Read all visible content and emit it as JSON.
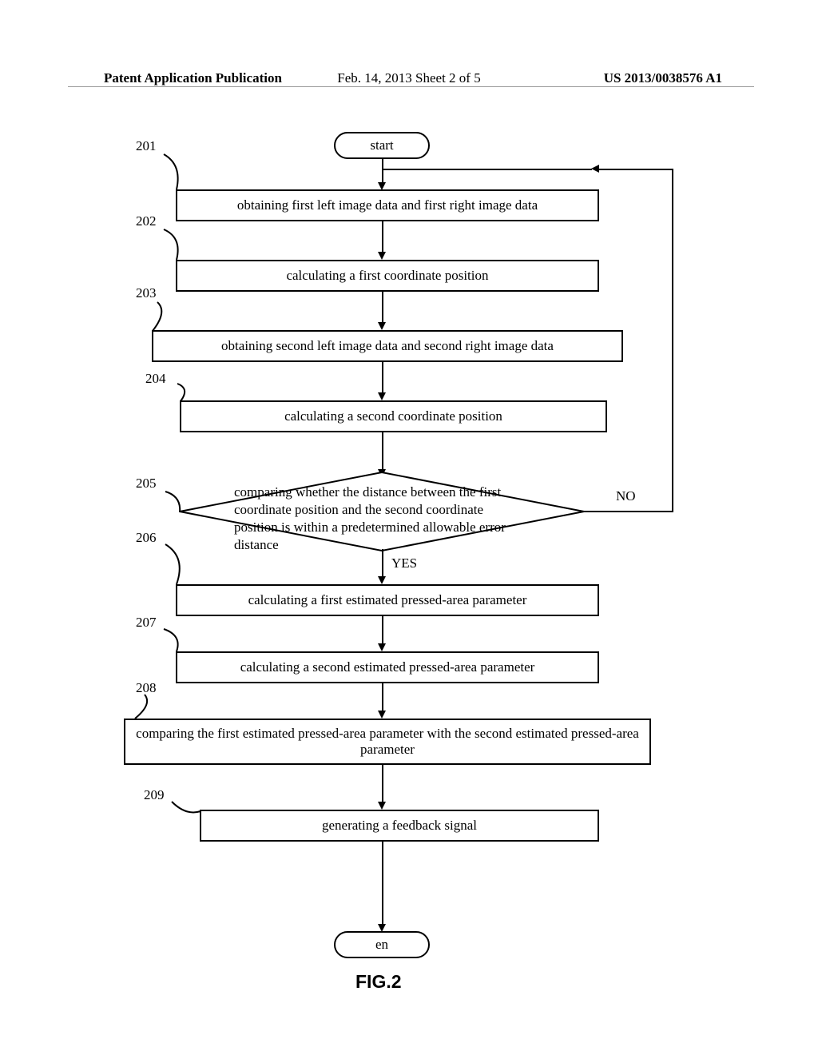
{
  "header": {
    "left": "Patent Application Publication",
    "center": "Feb. 14, 2013   Sheet 2 of 5",
    "right": "US 2013/0038576 A1"
  },
  "flowchart": {
    "start": "start",
    "end": "en",
    "steps": [
      {
        "num": "201",
        "text": "obtaining first left image data and first right image data"
      },
      {
        "num": "202",
        "text": "calculating a first coordinate position"
      },
      {
        "num": "203",
        "text": "obtaining second left image data and second right image data"
      },
      {
        "num": "204",
        "text": "calculating a second coordinate position"
      },
      {
        "num": "205",
        "text": "comparing whether the distance between the first coordinate position and the second coordinate position is within a predetermined allowable error distance"
      },
      {
        "num": "206",
        "text": "calculating a first estimated pressed-area parameter"
      },
      {
        "num": "207",
        "text": "calculating a second estimated pressed-area parameter"
      },
      {
        "num": "208",
        "text": "comparing the first estimated pressed-area parameter with the second estimated pressed-area parameter"
      },
      {
        "num": "209",
        "text": "generating a feedback signal"
      }
    ],
    "branches": {
      "yes": "YES",
      "no": "NO"
    }
  },
  "figure_label": "FIG.2"
}
